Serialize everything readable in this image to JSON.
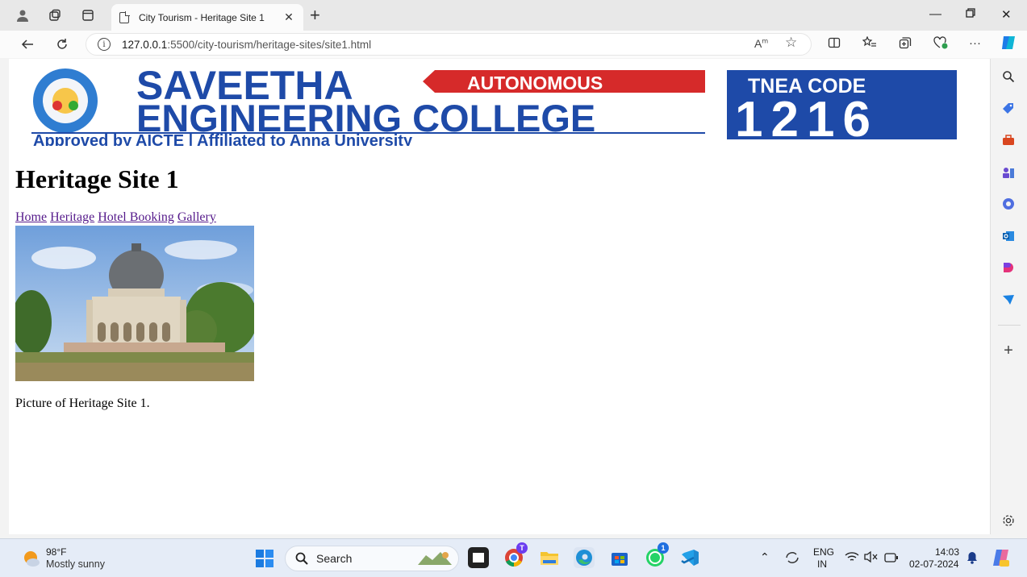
{
  "browser": {
    "tab_title": "City Tourism - Heritage Site 1",
    "url_host": "127.0.0.1",
    "url_path": ":5500/city-tourism/heritage-sites/site1.html"
  },
  "page": {
    "banner": {
      "name_line1": "SAVEETHA",
      "name_line2": "ENGINEERING COLLEGE",
      "autonomous": "AUTONOMOUS",
      "tagline": "Approved by AICTE | Affiliated to Anna University",
      "tnea_label": "TNEA CODE",
      "tnea_code": "1216"
    },
    "heading": "Heritage Site 1",
    "nav_links": [
      "Home",
      "Heritage",
      "Hotel Booking",
      "Gallery"
    ],
    "caption": "Picture of Heritage Site 1."
  },
  "taskbar": {
    "weather_temp": "98°F",
    "weather_desc": "Mostly sunny",
    "search_placeholder": "Search",
    "lang_top": "ENG",
    "lang_bottom": "IN",
    "time": "14:03",
    "date": "02-07-2024",
    "chrome_badge": "T",
    "whatsapp_badge": "1"
  },
  "colors": {
    "banner_blue": "#1e4aa8",
    "banner_red": "#d62a2a",
    "link_visited": "#551a8b"
  }
}
